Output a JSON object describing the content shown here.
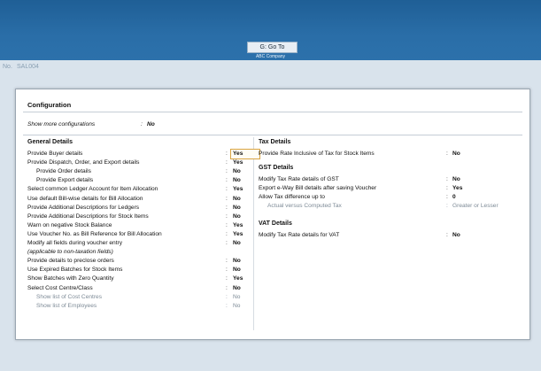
{
  "header": {
    "goto_label": "G: Go To",
    "company": "ABC Company"
  },
  "background": {
    "no_label": "No.",
    "voucher": "SAL004"
  },
  "dialog": {
    "title": "Configuration",
    "show_more": {
      "label": "Show more configurations",
      "colon": ":",
      "value": "No"
    },
    "general": {
      "heading": "General Details",
      "rows": [
        {
          "label": "Provide Buyer details",
          "value": "Yes",
          "indent": false,
          "muted": false,
          "selected": true
        },
        {
          "label": "Provide Dispatch, Order, and Export details",
          "value": "Yes",
          "indent": false,
          "muted": false
        },
        {
          "label": "Provide Order details",
          "value": "No",
          "indent": true,
          "muted": false
        },
        {
          "label": "Provide Export details",
          "value": "No",
          "indent": true,
          "muted": false
        },
        {
          "label": "Select common Ledger Account for Item Allocation",
          "value": "Yes",
          "indent": false,
          "muted": false
        },
        {
          "label": "Use default Bill-wise details for Bill Allocation",
          "value": "No",
          "indent": false,
          "muted": false
        },
        {
          "label": "Provide Additional Descriptions for Ledgers",
          "value": "No",
          "indent": false,
          "muted": false
        },
        {
          "label": "Provide Additional Descriptions for Stock Items",
          "value": "No",
          "indent": false,
          "muted": false
        },
        {
          "label": "Warn on negative Stock Balance",
          "value": "Yes",
          "indent": false,
          "muted": false
        },
        {
          "label": "Use Voucher No. as Bill Reference for Bill Allocation",
          "value": "Yes",
          "indent": false,
          "muted": false
        },
        {
          "label": "Modify all fields during voucher entry",
          "value": "No",
          "indent": false,
          "muted": false
        },
        {
          "label": "(applicable to non-taxation fields)",
          "value": "",
          "indent": false,
          "muted": false,
          "italic": true,
          "no_colon": true
        },
        {
          "label": "Provide details to preclose orders",
          "value": "No",
          "indent": false,
          "muted": false
        },
        {
          "label": "Use Expired Batches for Stock Items",
          "value": "No",
          "indent": false,
          "muted": false
        },
        {
          "label": "Show Batches with Zero Quantity",
          "value": "Yes",
          "indent": false,
          "muted": false
        },
        {
          "label": "Select Cost Centre/Class",
          "value": "No",
          "indent": false,
          "muted": false
        },
        {
          "label": "Show list of Cost Centres",
          "value": "No",
          "indent": true,
          "muted": true
        },
        {
          "label": "Show list of Employees",
          "value": "No",
          "indent": true,
          "muted": true
        }
      ]
    },
    "tax": {
      "heading": "Tax Details",
      "rows": [
        {
          "label": "Provide Rate Inclusive of Tax for Stock Items",
          "value": "No"
        }
      ]
    },
    "gst": {
      "heading": "GST Details",
      "rows": [
        {
          "label": "Modify Tax Rate details of GST",
          "value": "No",
          "muted": false,
          "indent": false
        },
        {
          "label": "Export e-Way Bill details after saving Voucher",
          "value": "Yes",
          "muted": false,
          "indent": false
        },
        {
          "label": "Allow Tax difference up to",
          "value": "0",
          "muted": false,
          "indent": false
        },
        {
          "label": "Actual versus Computed Tax",
          "value": "Greater or Lesser",
          "muted": true,
          "indent": true
        }
      ]
    },
    "vat": {
      "heading": "VAT Details",
      "rows": [
        {
          "label": "Modify Tax Rate details for VAT",
          "value": "No"
        }
      ]
    }
  }
}
